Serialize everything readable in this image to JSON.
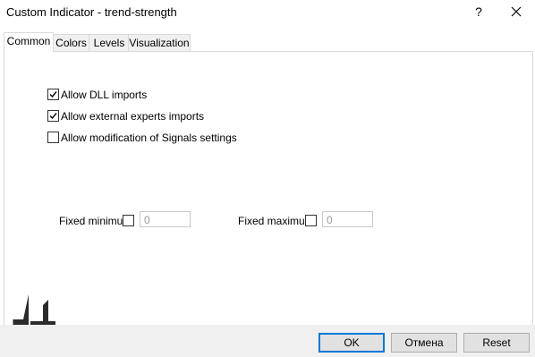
{
  "window": {
    "title": "Custom Indicator - trend-strength",
    "help_label": "?",
    "close_icon": "close-icon"
  },
  "tabs": [
    {
      "label": "Common",
      "active": true
    },
    {
      "label": "Colors",
      "active": false
    },
    {
      "label": "Levels",
      "active": false
    },
    {
      "label": "Visualization",
      "active": false
    }
  ],
  "common": {
    "allow_dll": {
      "label": "Allow DLL imports",
      "checked": true
    },
    "allow_external": {
      "label": "Allow external experts imports",
      "checked": true
    },
    "allow_signals": {
      "label": "Allow modification of Signals settings",
      "checked": false
    },
    "fixed_minimum": {
      "label": "Fixed minimum",
      "checked": false,
      "value": "0"
    },
    "fixed_maximum": {
      "label": "Fixed maximum",
      "checked": false,
      "value": "0"
    }
  },
  "buttons": {
    "ok": "OK",
    "cancel": "Отмена",
    "reset": "Reset"
  },
  "colors": {
    "accent": "#0078d7",
    "logo": "#2b2b2b"
  }
}
